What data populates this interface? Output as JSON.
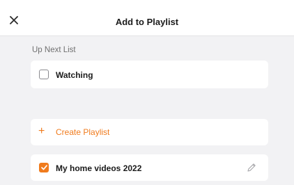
{
  "header": {
    "title": "Add to Playlist",
    "close_icon": "close-icon"
  },
  "up_next": {
    "section_label": "Up Next List",
    "items": [
      {
        "label": "Watching",
        "checked": false
      }
    ]
  },
  "create_playlist": {
    "label": "Create Playlist",
    "icon": "plus-icon"
  },
  "playlists": [
    {
      "label": "My home videos 2022",
      "checked": true,
      "edit_icon": "pencil-icon"
    }
  ],
  "colors": {
    "accent": "#f07b1d",
    "background": "#f2f2f4",
    "card": "#ffffff",
    "text": "#1b1b1b",
    "muted": "#707070"
  }
}
